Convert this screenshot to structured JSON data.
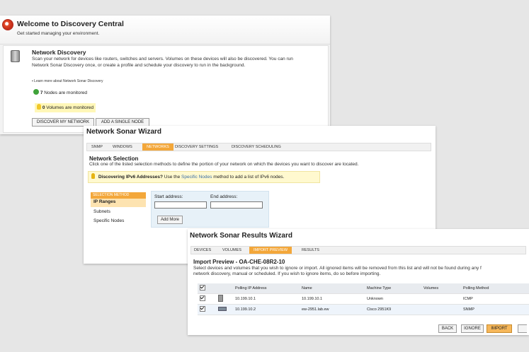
{
  "welcome": {
    "title": "Welcome to Discovery Central",
    "subtitle": "Get started managing your environment.",
    "network_discovery": {
      "heading": "Network Discovery",
      "description": "Scan your network for devices like routers, switches and servers. Volumes on these devices will also be discovered. You can run Network Sonar Discovery once, or create a profile and schedule your discovery to run in the background.",
      "learn_more": "Learn more about Network Sonar Discovery",
      "nodes_count": "7",
      "nodes_text": "Nodes are monitored",
      "volumes_count": "0",
      "volumes_text": "Volumes are monitored",
      "discover_button": "DISCOVER MY NETWORK",
      "add_node_button": "ADD A SINGLE NODE"
    }
  },
  "sonar_wizard": {
    "title": "Network Sonar Wizard",
    "steps": [
      "SNMP",
      "WINDOWS",
      "NETWORKS",
      "DISCOVERY SETTINGS",
      "DISCOVERY SCHEDULING"
    ],
    "active_step": 2,
    "section_title": "Network Selection",
    "instruction": "Click one of the listed selection methods to define the portion of your network on which the devices you want to discover are located.",
    "ipv6_label": "Discovering IPv6 Addresses?",
    "ipv6_use": "Use the",
    "ipv6_link": "Specific Nodes",
    "ipv6_rest": "method to add a list of IPv6 nodes.",
    "selection_header": "SELECTION METHOD",
    "methods": [
      "IP Ranges",
      "Subnets",
      "Specific Nodes"
    ],
    "start_label": "Start address:",
    "end_label": "End address:",
    "start_value": "",
    "end_value": "",
    "add_more": "Add More"
  },
  "results_wizard": {
    "title": "Network Sonar Results Wizard",
    "steps": [
      "DEVICES",
      "VOLUMES",
      "IMPORT PREVIEW",
      "RESULTS"
    ],
    "active_step": 2,
    "preview_title": "Import Preview - OA-CHE-08R2-10",
    "preview_text_1": "Select devices and volumes that you wish to ignore or import. All ignored items will be removed from this list and will not be found during any f",
    "preview_text_2": "network discovery, manual or scheduled. If you wish to ignore items, do so before importing.",
    "columns": [
      "Polling IP Address",
      "Name",
      "Machine Type",
      "Volumes",
      "Polling Method"
    ],
    "rows": [
      {
        "ip": "10.199.10.1",
        "name": "10.199.10.1",
        "type": "Unknown",
        "volumes": "",
        "method": "ICMP"
      },
      {
        "ip": "10.199.10.2",
        "name": "ew-2951.lab.ew",
        "type": "Cisco 2951K9",
        "volumes": "",
        "method": "SNMP"
      }
    ],
    "buttons": {
      "back": "BACK",
      "ignore": "IGNORE",
      "import": "IMPORT"
    }
  }
}
